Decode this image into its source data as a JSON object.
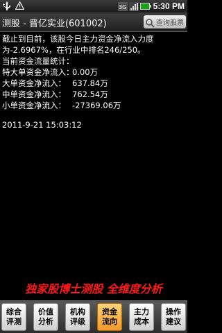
{
  "statusbar": {
    "time": "5:30 PM",
    "icons": [
      "usb-icon",
      "warning-icon",
      "3g-icon",
      "signal-icon",
      "battery-icon"
    ]
  },
  "titlebar": {
    "title": "测股 - 晋亿实业(601002)",
    "query_label": "查询股票"
  },
  "content": {
    "line1": "截止到目前，该股今日主力资金净流入力度",
    "line2": "为-2.6967%，在行业中排名246/250。",
    "line3": "当前资金流量统计：",
    "flows": [
      {
        "label": "特大单资金净流入：",
        "value": "0.00万"
      },
      {
        "label": "大单资金净流入：",
        "value": "637.84万"
      },
      {
        "label": "中单资金净流入：",
        "value": "762.54万"
      },
      {
        "label": "小单资金净流入：",
        "value": "-27369.06万"
      }
    ],
    "timestamp": "2011-9-21 15:03:12"
  },
  "slogan": "独家股博士测股 全维度分析",
  "tabs": [
    {
      "line1": "综合",
      "line2": "评测",
      "active": false
    },
    {
      "line1": "价值",
      "line2": "分析",
      "active": false
    },
    {
      "line1": "机构",
      "line2": "评级",
      "active": false
    },
    {
      "line1": "资金",
      "line2": "流向",
      "active": true
    },
    {
      "line1": "主力",
      "line2": "成本",
      "active": false
    },
    {
      "line1": "操作",
      "line2": "建议",
      "active": false
    }
  ],
  "colors": {
    "slogan": "#ff1a1a",
    "active_tab": "#f09a2a",
    "background": "#000000"
  }
}
